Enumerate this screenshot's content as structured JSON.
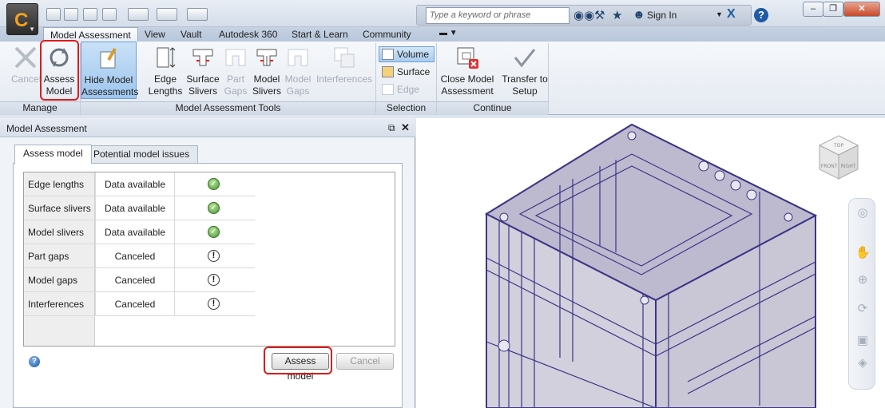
{
  "titlebar": {
    "search_placeholder": "Type a keyword or phrase",
    "sign_in": "Sign In",
    "help": "?"
  },
  "tabs": [
    "Model Assessment",
    "View",
    "Vault",
    "Autodesk 360",
    "Start & Learn",
    "Community"
  ],
  "active_tab": "Model Assessment",
  "ribbon": {
    "manage": {
      "label": "Manage",
      "cancel": "Cancel",
      "assess_model": "Assess Model"
    },
    "tools": {
      "label": "Model Assessment Tools",
      "hide": "Hide Model Assessments",
      "edge_lengths": "Edge Lengths",
      "surface_slivers": "Surface Slivers",
      "part_gaps": "Part Gaps",
      "model_slivers": "Model Slivers",
      "model_gaps": "Model Gaps",
      "interferences": "Interferences"
    },
    "selection": {
      "label": "Selection",
      "volume": "Volume",
      "surface": "Surface",
      "edge": "Edge"
    },
    "continue": {
      "label": "Continue",
      "close": "Close Model Assessment",
      "transfer": "Transfer to Setup"
    }
  },
  "palette": {
    "title": "Model Assessment",
    "tabs": [
      "Assess model",
      "Potential model issues"
    ],
    "rows": [
      {
        "name": "Edge lengths",
        "status": "Data available",
        "icon": "check-icon"
      },
      {
        "name": "Surface slivers",
        "status": "Data available",
        "icon": "check-icon"
      },
      {
        "name": "Model slivers",
        "status": "Data available",
        "icon": "check-icon"
      },
      {
        "name": "Part gaps",
        "status": "Canceled",
        "icon": "exclamation-icon"
      },
      {
        "name": "Model gaps",
        "status": "Canceled",
        "icon": "exclamation-icon"
      },
      {
        "name": "Interferences",
        "status": "Canceled",
        "icon": "exclamation-icon"
      }
    ],
    "assess_button": "Assess model",
    "cancel_button": "Cancel"
  },
  "viewcube": {
    "top": "TOP",
    "front": "FRONT",
    "right": "RIGHT"
  },
  "colors": {
    "accent": "#e01a1a",
    "ribbon_selected": "#9ec6ed",
    "model_edge": "#3a3585",
    "model_fill": "#b6b2c8"
  }
}
